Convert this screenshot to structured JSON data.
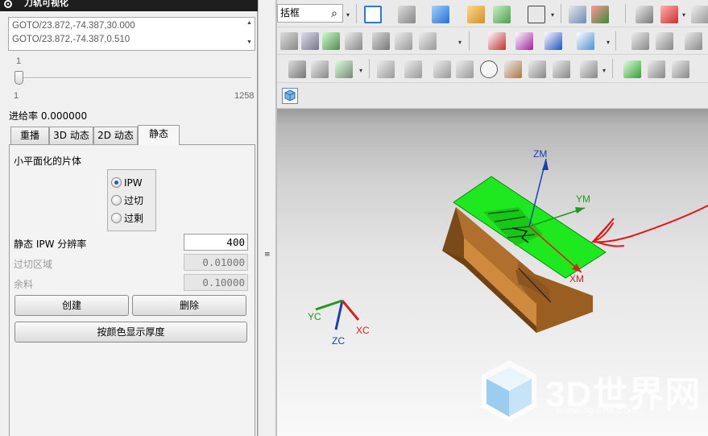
{
  "dialog": {
    "title": "刀轨可视化",
    "gcode_lines": [
      "GOTO/23.872,-74.387,30.000",
      "GOTO/23.872,-74.387,0.510"
    ],
    "slider": {
      "current_label": "1",
      "min_label": "1",
      "max_label": "1258",
      "value": 1
    },
    "feed_label": "进给率 0.000000",
    "tabs": [
      {
        "label": "重播",
        "active": false
      },
      {
        "label": "3D 动态",
        "active": false
      },
      {
        "label": "2D 动态",
        "active": false
      },
      {
        "label": "静态",
        "active": true
      }
    ],
    "group_label": "小平面化的片体",
    "radios": [
      {
        "label": "IPW",
        "selected": true
      },
      {
        "label": "过切",
        "selected": false
      },
      {
        "label": "过剩",
        "selected": false
      }
    ],
    "fields": [
      {
        "label": "静态 IPW 分辨率",
        "value": "400",
        "enabled": true
      },
      {
        "label": "过切区域",
        "value": "0.01000",
        "enabled": false
      },
      {
        "label": "余料",
        "value": "0.10000",
        "enabled": false
      }
    ],
    "buttons": {
      "create": "创建",
      "delete": "删除",
      "show_thickness": "按颜色显示厚度"
    }
  },
  "toolbar": {
    "filter_value": "括框",
    "icons_row1": [
      "fit-view-icon",
      "render-style-icon",
      "shaded-cube-icon",
      "folder-open-icon",
      "clipping-plane-icon",
      "background-icon",
      "wcs-orient-icon",
      "wcs-display-icon",
      "layer-icon",
      "csys-icon"
    ],
    "icons_row2": [
      "clamp-icon",
      "machine-icon",
      "toolpath-list-icon",
      "postprocess-icon",
      "verify-icon",
      "rotate-icon",
      "generate-path-icon",
      "replay-path-icon",
      "display-tool-icon",
      "tool-axis-icon",
      "geometry-icon",
      "operation-icon"
    ],
    "icons_row3": [
      "probe-icon",
      "shop-doc-icon",
      "drill-icon",
      "sequence-icon",
      "transform-icon",
      "feed-icon",
      "measure-icon",
      "circle-icon",
      "curve-icon",
      "layout-icon",
      "material-icon",
      "part-icon",
      "check-icon",
      "cut-icon",
      "edit-icon",
      "list-icon"
    ]
  },
  "viewport": {
    "axis_labels": {
      "zm": "ZM",
      "ym": "YM",
      "xm": "XM",
      "yc": "YC",
      "zc": "ZC",
      "xc": "XC"
    },
    "watermark": {
      "text": "3D世界网",
      "url": "WWW.3DSJW.COM"
    },
    "colors": {
      "part": "#b7722a",
      "ipw_sheet": "#1ee81e",
      "annotation": "#e01818"
    }
  }
}
